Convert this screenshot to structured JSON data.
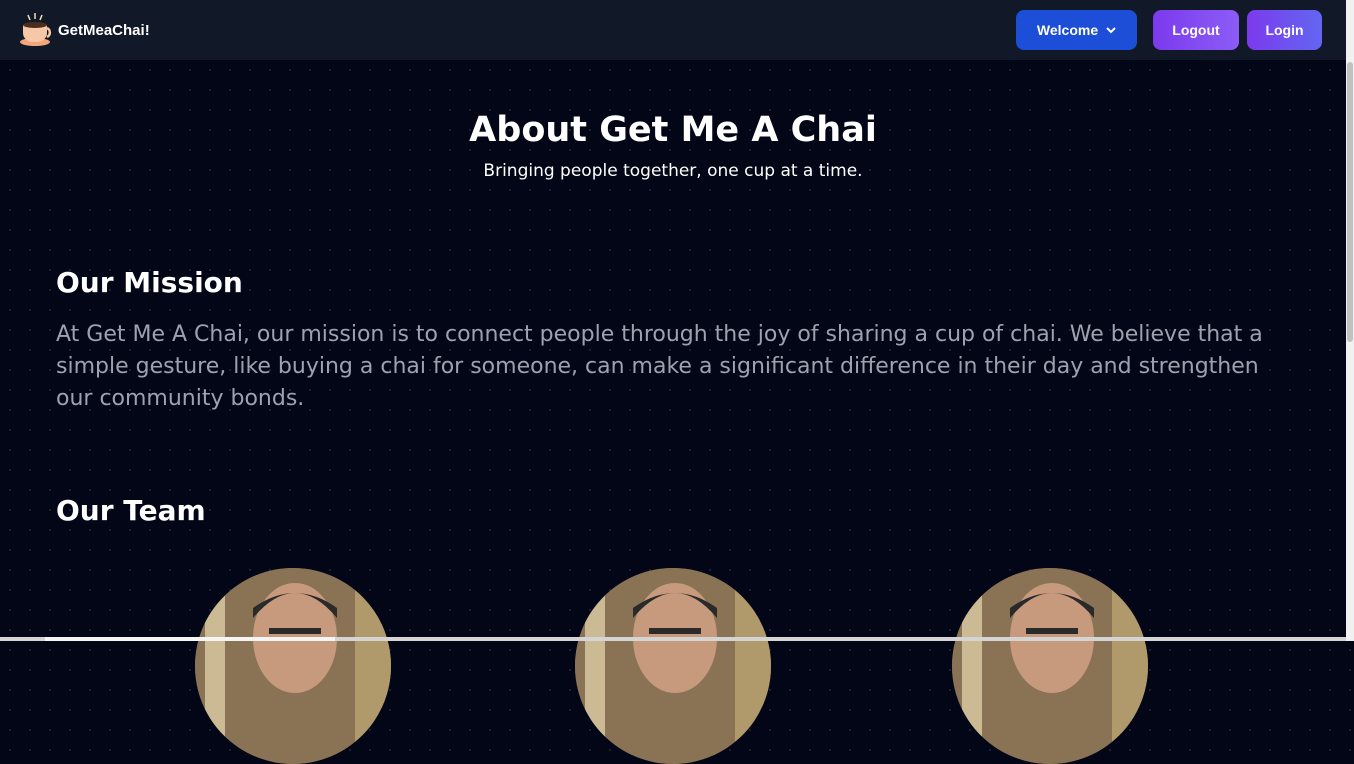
{
  "nav": {
    "brand": "GetMeaChai!",
    "welcome_label": "Welcome",
    "logout_label": "Logout",
    "login_label": "Login"
  },
  "hero": {
    "title": "About Get Me A Chai",
    "subtitle": "Bringing people together, one cup at a time."
  },
  "mission": {
    "title": "Our Mission",
    "text": "At Get Me A Chai, our mission is to connect people through the joy of sharing a cup of chai. We believe that a simple gesture, like buying a chai for someone, can make a significant difference in their day and strengthen our community bonds."
  },
  "team": {
    "title": "Our Team",
    "members": 3
  },
  "colors": {
    "background": "#020617",
    "navbar": "#111827",
    "welcome_button": "#1d4ed8",
    "logout_button": "#7c3aed",
    "login_button": "#6366f1"
  }
}
